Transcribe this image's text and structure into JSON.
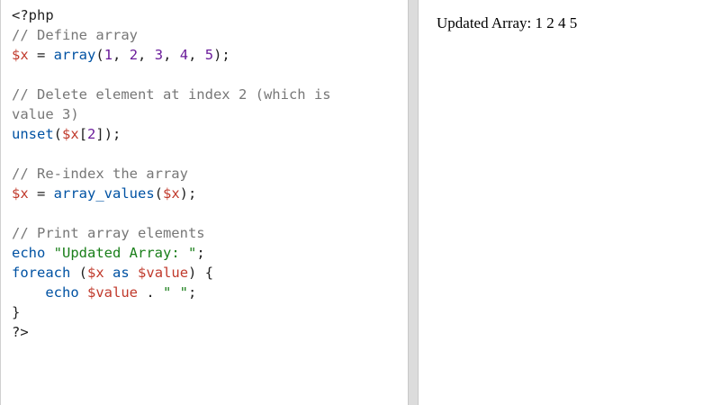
{
  "editor": {
    "lines": [
      [
        {
          "t": "<?php",
          "c": "c-plain"
        }
      ],
      [
        {
          "t": "// Define array",
          "c": "c-comment"
        }
      ],
      [
        {
          "t": "$x",
          "c": "c-var"
        },
        {
          "t": " = ",
          "c": "c-plain"
        },
        {
          "t": "array",
          "c": "c-fn"
        },
        {
          "t": "(",
          "c": "c-plain"
        },
        {
          "t": "1",
          "c": "c-num"
        },
        {
          "t": ", ",
          "c": "c-plain"
        },
        {
          "t": "2",
          "c": "c-num"
        },
        {
          "t": ", ",
          "c": "c-plain"
        },
        {
          "t": "3",
          "c": "c-num"
        },
        {
          "t": ", ",
          "c": "c-plain"
        },
        {
          "t": "4",
          "c": "c-num"
        },
        {
          "t": ", ",
          "c": "c-plain"
        },
        {
          "t": "5",
          "c": "c-num"
        },
        {
          "t": ");",
          "c": "c-plain"
        }
      ],
      [
        {
          "t": "",
          "c": "c-plain"
        }
      ],
      [
        {
          "t": "// Delete element at index 2 (which is",
          "c": "c-comment"
        }
      ],
      [
        {
          "t": "value 3)",
          "c": "c-comment"
        }
      ],
      [
        {
          "t": "unset",
          "c": "c-fn"
        },
        {
          "t": "(",
          "c": "c-plain"
        },
        {
          "t": "$x",
          "c": "c-var"
        },
        {
          "t": "[",
          "c": "c-plain"
        },
        {
          "t": "2",
          "c": "c-num"
        },
        {
          "t": "]);",
          "c": "c-plain"
        }
      ],
      [
        {
          "t": "",
          "c": "c-plain"
        }
      ],
      [
        {
          "t": "// Re-index the array",
          "c": "c-comment"
        }
      ],
      [
        {
          "t": "$x",
          "c": "c-var"
        },
        {
          "t": " = ",
          "c": "c-plain"
        },
        {
          "t": "array_values",
          "c": "c-fn"
        },
        {
          "t": "(",
          "c": "c-plain"
        },
        {
          "t": "$x",
          "c": "c-var"
        },
        {
          "t": ");",
          "c": "c-plain"
        }
      ],
      [
        {
          "t": "",
          "c": "c-plain"
        }
      ],
      [
        {
          "t": "// Print array elements",
          "c": "c-comment"
        }
      ],
      [
        {
          "t": "echo",
          "c": "c-kw"
        },
        {
          "t": " ",
          "c": "c-plain"
        },
        {
          "t": "\"Updated Array: \"",
          "c": "c-str"
        },
        {
          "t": ";",
          "c": "c-plain"
        }
      ],
      [
        {
          "t": "foreach",
          "c": "c-kw"
        },
        {
          "t": " (",
          "c": "c-plain"
        },
        {
          "t": "$x",
          "c": "c-var"
        },
        {
          "t": " ",
          "c": "c-plain"
        },
        {
          "t": "as",
          "c": "c-kw"
        },
        {
          "t": " ",
          "c": "c-plain"
        },
        {
          "t": "$value",
          "c": "c-var"
        },
        {
          "t": ") {",
          "c": "c-plain"
        }
      ],
      [
        {
          "t": "    ",
          "c": "c-plain"
        },
        {
          "t": "echo",
          "c": "c-kw"
        },
        {
          "t": " ",
          "c": "c-plain"
        },
        {
          "t": "$value",
          "c": "c-var"
        },
        {
          "t": " . ",
          "c": "c-plain"
        },
        {
          "t": "\" \"",
          "c": "c-str"
        },
        {
          "t": ";",
          "c": "c-plain"
        }
      ],
      [
        {
          "t": "}",
          "c": "c-plain"
        }
      ],
      [
        {
          "t": "?>",
          "c": "c-plain"
        }
      ]
    ]
  },
  "output": {
    "text": "Updated Array: 1 2 4 5"
  },
  "colors": {
    "comment": "#777777",
    "variable": "#c0392b",
    "keyword": "#0052a3",
    "number": "#6a1b9a",
    "string": "#1a7f1a",
    "splitter": "#dcdcdc"
  }
}
